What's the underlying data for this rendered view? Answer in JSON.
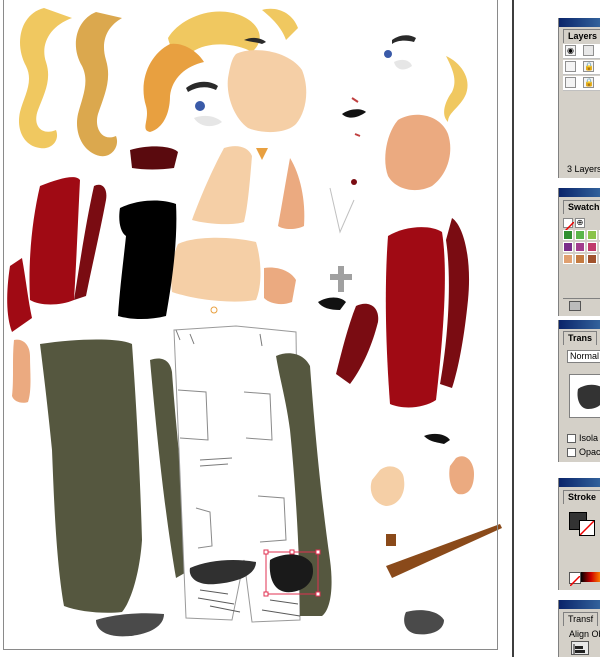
{
  "panels": {
    "layers": {
      "tab_label": "Layers",
      "status": "3 Layers"
    },
    "swatches": {
      "tab_label": "Swatch",
      "colors": [
        "#2f8f2f",
        "#5ab54a",
        "#8bc34a",
        "#1f5f1f",
        "#7a2d8a",
        "#a23c8c",
        "#c03a6b",
        "#5e2a74",
        "#e0a070",
        "#c47a40",
        "#a0522d",
        "#6b3b1f"
      ]
    },
    "transparency": {
      "tab_label": "Trans",
      "blend_mode": "Normal",
      "isolate_label": "Isola",
      "opacity_mask_label": "Opac"
    },
    "stroke": {
      "tab_label": "Stroke"
    },
    "transform": {
      "tab_label": "Transf",
      "align_label": "Align Ob"
    }
  },
  "colors": {
    "panel_bg": "#d4d0c8",
    "title_bar": "#0a246a",
    "hair_yellow": "#f0c860",
    "hair_orange": "#e8a040",
    "skin": "#f5cfa6",
    "skin_dark": "#e8a47c",
    "jacket_red": "#a00a14",
    "jacket_dark": "#7a0c12",
    "pants_olive": "#55573f",
    "shoe_gray": "#4a4a4a",
    "selection": "#e03050"
  }
}
